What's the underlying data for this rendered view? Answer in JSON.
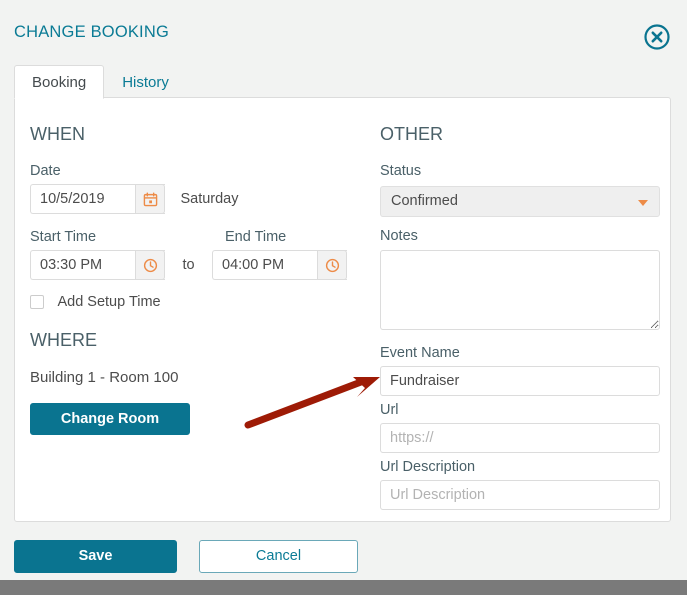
{
  "header": {
    "title": "CHANGE BOOKING",
    "close_icon": "close-circle-icon"
  },
  "tabs": [
    {
      "label": "Booking",
      "active": true
    },
    {
      "label": "History",
      "active": false
    }
  ],
  "sections": {
    "when": {
      "heading": "WHEN",
      "date": {
        "label": "Date",
        "value": "10/5/2019",
        "icon": "calendar-icon",
        "day_of_week": "Saturday"
      },
      "start_time": {
        "label": "Start Time",
        "value": "03:30 PM",
        "icon": "clock-icon"
      },
      "separator": "to",
      "end_time": {
        "label": "End Time",
        "value": "04:00 PM",
        "icon": "clock-icon"
      },
      "setup_time": {
        "label": "Add Setup Time",
        "checked": false
      }
    },
    "where": {
      "heading": "WHERE",
      "room": "Building 1 - Room 100",
      "change_room_label": "Change Room"
    },
    "other": {
      "heading": "OTHER",
      "status": {
        "label": "Status",
        "value": "Confirmed",
        "caret_icon": "chevron-down-icon"
      },
      "notes": {
        "label": "Notes",
        "value": "",
        "placeholder": ""
      },
      "event_name": {
        "label": "Event Name",
        "value": "Fundraiser",
        "placeholder": ""
      },
      "url": {
        "label": "Url",
        "value": "",
        "placeholder": "https://"
      },
      "url_description": {
        "label": "Url Description",
        "value": "",
        "placeholder": "Url Description"
      }
    }
  },
  "footer": {
    "save_label": "Save",
    "cancel_label": "Cancel"
  },
  "annotation": {
    "type": "arrow",
    "color": "#9e1b06",
    "points_to": "event-name-input"
  },
  "colors": {
    "accent_teal": "#0a7490",
    "title_teal": "#0b7b95",
    "heading_slate": "#4a6068",
    "icon_orange": "#ed8b47",
    "annotation_red": "#9e1b06",
    "page_bg": "#f2f3f2",
    "panel_bg": "#ffffff",
    "border_gray": "#dcdcdc"
  }
}
